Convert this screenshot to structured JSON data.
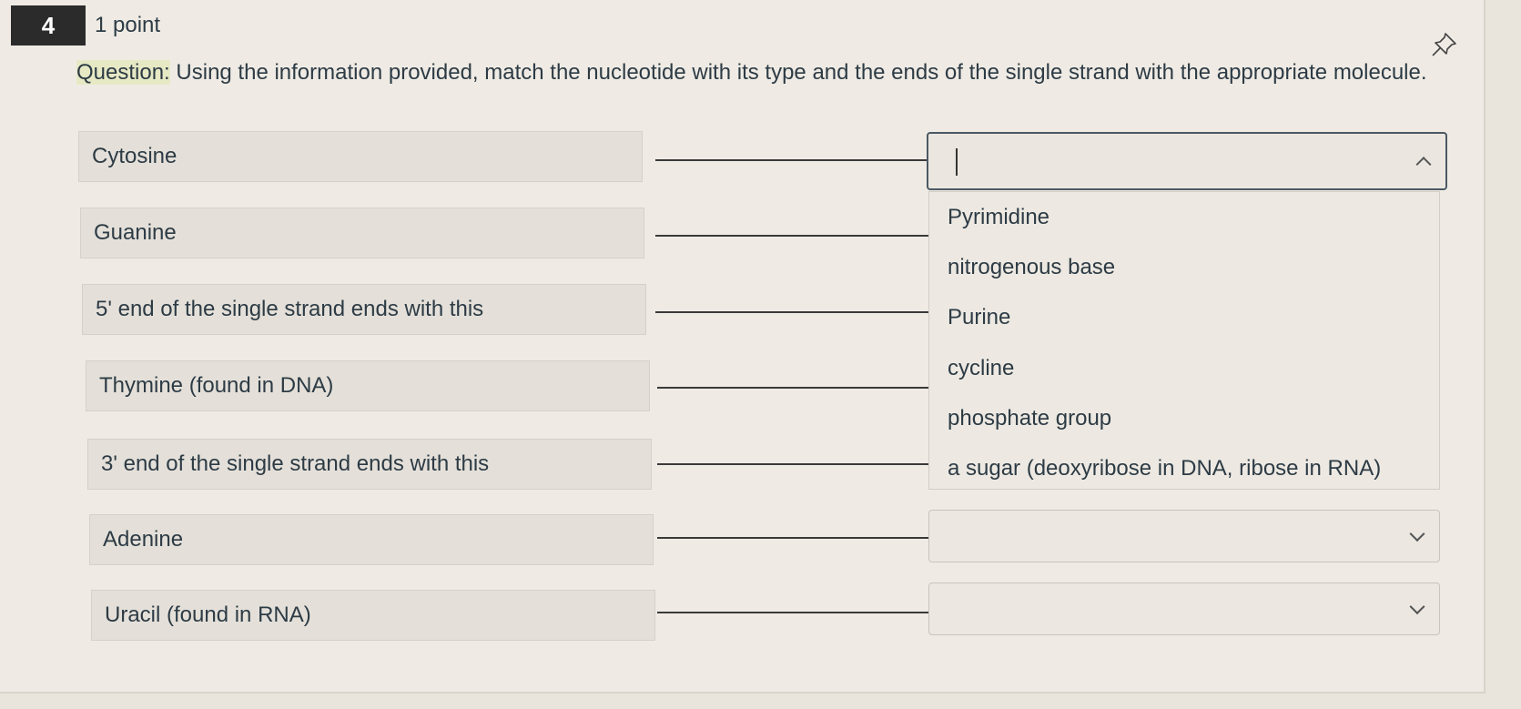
{
  "question": {
    "number": "4",
    "points": "1 point",
    "label": "Question:",
    "text": " Using the information provided, match the nucleotide with its type and the ends of the single strand with the appropriate molecule."
  },
  "prompts": [
    "Cytosine",
    "Guanine",
    "5' end of the single strand ends with this",
    "Thymine (found in DNA)",
    "3' end of the single strand ends with this",
    "Adenine",
    "Uracil (found in RNA)"
  ],
  "dropdown": {
    "options": [
      "Pyrimidine",
      "nitrogenous base",
      "Purine",
      "cycline",
      "phosphate group",
      "a sugar (deoxyribose in DNA, ribose in RNA)"
    ]
  },
  "icons": {
    "pin": "pin-icon",
    "caret_open": "chevron-up-icon",
    "caret_closed": "chevron-down-icon"
  },
  "colors": {
    "question_number_bg": "#2b2b2b",
    "question_label_highlight": "#e7e9c5"
  }
}
